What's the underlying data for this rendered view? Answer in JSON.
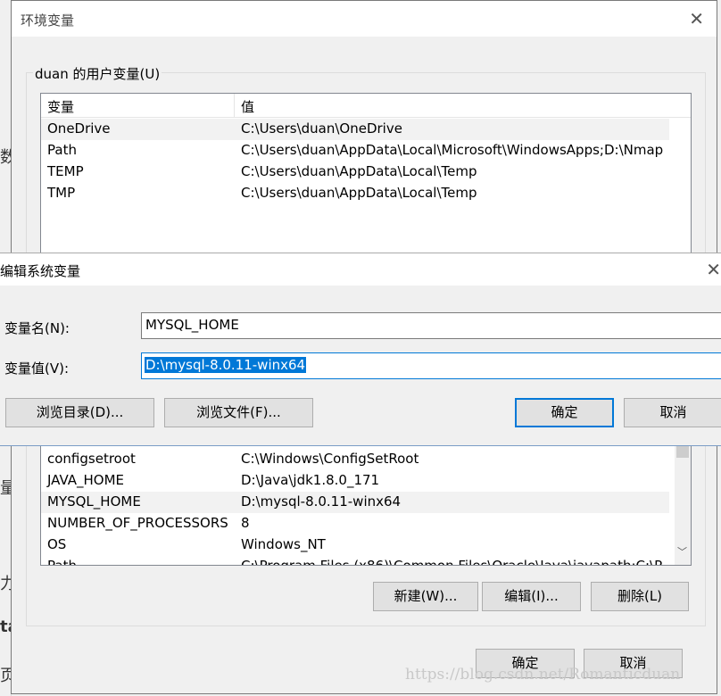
{
  "background": {
    "fragments": [
      "数",
      "量",
      "力",
      "ta",
      "页"
    ]
  },
  "env_dialog": {
    "title": "环境变量",
    "close_icon": "close-icon",
    "user_group_label": "duan 的用户变量(U)",
    "user_columns": [
      "变量",
      "值"
    ],
    "user_vars": [
      {
        "name": "OneDrive",
        "value": "C:\\Users\\duan\\OneDrive"
      },
      {
        "name": "Path",
        "value": "C:\\Users\\duan\\AppData\\Local\\Microsoft\\WindowsApps;D:\\Nmap"
      },
      {
        "name": "TEMP",
        "value": "C:\\Users\\duan\\AppData\\Local\\Temp"
      },
      {
        "name": "TMP",
        "value": "C:\\Users\\duan\\AppData\\Local\\Temp"
      }
    ],
    "system_vars": [
      {
        "name": "configsetroot",
        "value": "C:\\Windows\\ConfigSetRoot"
      },
      {
        "name": "JAVA_HOME",
        "value": "D:\\Java\\jdk1.8.0_171"
      },
      {
        "name": "MYSQL_HOME",
        "value": "D:\\mysql-8.0.11-winx64"
      },
      {
        "name": "NUMBER_OF_PROCESSORS",
        "value": "8"
      },
      {
        "name": "OS",
        "value": "Windows_NT"
      },
      {
        "name": "Path",
        "value": "C:\\Program Files (x86)\\Common Files\\Oracle\\Java\\javapath;C:\\P"
      }
    ],
    "new_button": "新建(W)...",
    "edit_button": "编辑(I)...",
    "delete_button": "删除(L)",
    "ok_button": "确定",
    "cancel_button": "取消"
  },
  "edit_dialog": {
    "title": "编辑系统变量",
    "close_icon": "close-icon",
    "name_label": "变量名(N):",
    "name_value": "MYSQL_HOME",
    "value_label": "变量值(V):",
    "value_value": "D:\\mysql-8.0.11-winx64",
    "browse_dir_button": "浏览目录(D)...",
    "browse_file_button": "浏览文件(F)...",
    "ok_button": "确定",
    "cancel_button": "取消"
  },
  "watermark": "https://blog.csdn.net/Romanticduan"
}
